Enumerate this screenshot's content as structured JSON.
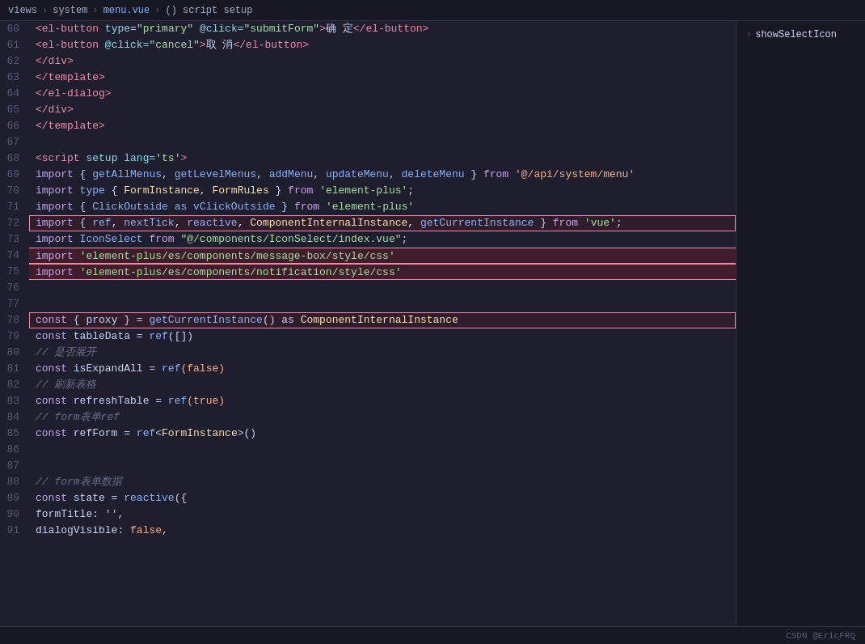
{
  "breadcrumb": {
    "parts": [
      "views",
      "system",
      "menu.vue",
      "() script setup"
    ]
  },
  "right_panel": {
    "item": "showSelectIcon",
    "arrow": "›"
  },
  "lines": [
    {
      "num": 60,
      "tokens": [
        {
          "t": "                    ",
          "c": ""
        },
        {
          "t": "<",
          "c": "tag"
        },
        {
          "t": "el-button",
          "c": "tag"
        },
        {
          "t": " ",
          "c": ""
        },
        {
          "t": "type",
          "c": "attr"
        },
        {
          "t": "=",
          "c": "punct"
        },
        {
          "t": "\"primary\"",
          "c": "str"
        },
        {
          "t": " @click=",
          "c": "attr"
        },
        {
          "t": "\"submitForm\"",
          "c": "str"
        },
        {
          "t": ">",
          "c": "tag"
        },
        {
          "t": "确 定",
          "c": "white"
        },
        {
          "t": "</",
          "c": "tag"
        },
        {
          "t": "el-button",
          "c": "tag"
        },
        {
          "t": ">",
          "c": "tag"
        }
      ]
    },
    {
      "num": 61,
      "tokens": [
        {
          "t": "                    ",
          "c": ""
        },
        {
          "t": "<",
          "c": "tag"
        },
        {
          "t": "el-button",
          "c": "tag"
        },
        {
          "t": " @click=",
          "c": "attr"
        },
        {
          "t": "\"cancel\"",
          "c": "str"
        },
        {
          "t": ">",
          "c": "tag"
        },
        {
          "t": "取 消",
          "c": "white"
        },
        {
          "t": "</",
          "c": "tag"
        },
        {
          "t": "el-button",
          "c": "tag"
        },
        {
          "t": ">",
          "c": "tag"
        }
      ]
    },
    {
      "num": 62,
      "tokens": [
        {
          "t": "                ",
          "c": ""
        },
        {
          "t": "</",
          "c": "tag"
        },
        {
          "t": "div",
          "c": "tag"
        },
        {
          "t": ">",
          "c": "tag"
        }
      ]
    },
    {
      "num": 63,
      "tokens": [
        {
          "t": "            ",
          "c": ""
        },
        {
          "t": "</",
          "c": "tag"
        },
        {
          "t": "template",
          "c": "tag"
        },
        {
          "t": ">",
          "c": "tag"
        }
      ]
    },
    {
      "num": 64,
      "tokens": [
        {
          "t": "        ",
          "c": ""
        },
        {
          "t": "</",
          "c": "tag"
        },
        {
          "t": "el-dialog",
          "c": "tag"
        },
        {
          "t": ">",
          "c": "tag"
        }
      ]
    },
    {
      "num": 65,
      "tokens": [
        {
          "t": "    ",
          "c": ""
        },
        {
          "t": "</",
          "c": "tag"
        },
        {
          "t": "div",
          "c": "tag"
        },
        {
          "t": ">",
          "c": "tag"
        }
      ]
    },
    {
      "num": 66,
      "tokens": [
        {
          "t": "</",
          "c": "tag"
        },
        {
          "t": "template",
          "c": "tag"
        },
        {
          "t": ">",
          "c": "tag"
        }
      ]
    },
    {
      "num": 67,
      "tokens": []
    },
    {
      "num": 68,
      "tokens": [
        {
          "t": "<",
          "c": "tag"
        },
        {
          "t": "script",
          "c": "tag"
        },
        {
          "t": " setup",
          "c": "attr"
        },
        {
          "t": " lang=",
          "c": "attr"
        },
        {
          "t": "'ts'",
          "c": "str"
        },
        {
          "t": ">",
          "c": "tag"
        }
      ]
    },
    {
      "num": 69,
      "tokens": [
        {
          "t": "import",
          "c": "kw"
        },
        {
          "t": " { ",
          "c": "white"
        },
        {
          "t": "getAllMenus",
          "c": "fn"
        },
        {
          "t": ", ",
          "c": "white"
        },
        {
          "t": "getLevelMenus",
          "c": "fn"
        },
        {
          "t": ", ",
          "c": "white"
        },
        {
          "t": "addMenu",
          "c": "fn"
        },
        {
          "t": ", ",
          "c": "white"
        },
        {
          "t": "updateMenu",
          "c": "fn"
        },
        {
          "t": ", ",
          "c": "white"
        },
        {
          "t": "deleteMenu",
          "c": "fn"
        },
        {
          "t": " } ",
          "c": "white"
        },
        {
          "t": "from",
          "c": "kw"
        },
        {
          "t": " ",
          "c": ""
        },
        {
          "t": "'@/api/system/menu'",
          "c": "str-orange"
        }
      ]
    },
    {
      "num": 70,
      "tokens": [
        {
          "t": "import",
          "c": "kw"
        },
        {
          "t": " type",
          "c": "kw2"
        },
        {
          "t": " { ",
          "c": "white"
        },
        {
          "t": "FormInstance",
          "c": "type"
        },
        {
          "t": ", ",
          "c": "white"
        },
        {
          "t": "FormRules",
          "c": "type"
        },
        {
          "t": " } ",
          "c": "white"
        },
        {
          "t": "from",
          "c": "kw"
        },
        {
          "t": " ",
          "c": ""
        },
        {
          "t": "'element-plus'",
          "c": "str"
        },
        {
          "t": ";",
          "c": "white"
        }
      ]
    },
    {
      "num": 71,
      "tokens": [
        {
          "t": "import",
          "c": "kw"
        },
        {
          "t": " { ",
          "c": "white"
        },
        {
          "t": "ClickOutside",
          "c": "fn"
        },
        {
          "t": " as ",
          "c": "kw2"
        },
        {
          "t": "vClickOutside",
          "c": "fn"
        },
        {
          "t": " } ",
          "c": "white"
        },
        {
          "t": "from",
          "c": "kw"
        },
        {
          "t": " ",
          "c": ""
        },
        {
          "t": "'element-plus'",
          "c": "str"
        }
      ]
    },
    {
      "num": 72,
      "tokens": [
        {
          "t": "import",
          "c": "kw"
        },
        {
          "t": " { ",
          "c": "white"
        },
        {
          "t": "ref",
          "c": "fn"
        },
        {
          "t": ", ",
          "c": "white"
        },
        {
          "t": "nextTick",
          "c": "fn"
        },
        {
          "t": ", ",
          "c": "white"
        },
        {
          "t": "reactive",
          "c": "fn"
        },
        {
          "t": ", ",
          "c": "white"
        },
        {
          "t": "ComponentInternalInstance",
          "c": "type"
        },
        {
          "t": ", ",
          "c": "white"
        },
        {
          "t": "getCurrentInstance",
          "c": "fn"
        },
        {
          "t": " } ",
          "c": "white"
        },
        {
          "t": "from",
          "c": "kw"
        },
        {
          "t": " ",
          "c": ""
        },
        {
          "t": "'vue'",
          "c": "str"
        },
        {
          "t": ";",
          "c": "white"
        }
      ],
      "box": true
    },
    {
      "num": 73,
      "tokens": [
        {
          "t": "import",
          "c": "kw"
        },
        {
          "t": " IconSelect ",
          "c": "fn"
        },
        {
          "t": "from",
          "c": "kw"
        },
        {
          "t": " ",
          "c": ""
        },
        {
          "t": "\"@/components/IconSelect/index.vue\"",
          "c": "str"
        },
        {
          "t": ";",
          "c": "white"
        }
      ]
    },
    {
      "num": 74,
      "tokens": [
        {
          "t": "import",
          "c": "kw"
        },
        {
          "t": " ",
          "c": ""
        },
        {
          "t": "'element-plus/es/components/message-box/style/css'",
          "c": "str"
        }
      ],
      "highlight": true
    },
    {
      "num": 75,
      "tokens": [
        {
          "t": "import",
          "c": "kw"
        },
        {
          "t": " ",
          "c": ""
        },
        {
          "t": "'element-plus/es/components/notification/style/css'",
          "c": "str"
        }
      ],
      "highlight": true
    },
    {
      "num": 76,
      "tokens": []
    },
    {
      "num": 77,
      "tokens": []
    },
    {
      "num": 78,
      "tokens": [
        {
          "t": "const",
          "c": "kw"
        },
        {
          "t": " { ",
          "c": "white"
        },
        {
          "t": "proxy",
          "c": "var"
        },
        {
          "t": " } = ",
          "c": "white"
        },
        {
          "t": "getCurrentInstance",
          "c": "fn"
        },
        {
          "t": "() as ",
          "c": "white"
        },
        {
          "t": "ComponentInternalInstance",
          "c": "type"
        }
      ],
      "box": true
    },
    {
      "num": 79,
      "tokens": [
        {
          "t": "const",
          "c": "kw"
        },
        {
          "t": " tableData = ",
          "c": "white"
        },
        {
          "t": "ref",
          "c": "fn"
        },
        {
          "t": "([])",
          "c": "white"
        }
      ]
    },
    {
      "num": 80,
      "tokens": [
        {
          "t": "// 是否展开",
          "c": "comment-cn"
        }
      ]
    },
    {
      "num": 81,
      "tokens": [
        {
          "t": "const",
          "c": "kw"
        },
        {
          "t": " isExpandAll = ",
          "c": "white"
        },
        {
          "t": "ref",
          "c": "fn"
        },
        {
          "t": "(false)",
          "c": "orange"
        }
      ]
    },
    {
      "num": 82,
      "tokens": [
        {
          "t": "// 刷新表格",
          "c": "comment-cn"
        }
      ]
    },
    {
      "num": 83,
      "tokens": [
        {
          "t": "const",
          "c": "kw"
        },
        {
          "t": " refreshTable = ",
          "c": "white"
        },
        {
          "t": "ref",
          "c": "fn"
        },
        {
          "t": "(true)",
          "c": "orange"
        }
      ]
    },
    {
      "num": 84,
      "tokens": [
        {
          "t": "// form表单ref",
          "c": "comment-cn"
        }
      ]
    },
    {
      "num": 85,
      "tokens": [
        {
          "t": "const",
          "c": "kw"
        },
        {
          "t": " refForm = ",
          "c": "white"
        },
        {
          "t": "ref",
          "c": "fn"
        },
        {
          "t": "<",
          "c": "white"
        },
        {
          "t": "FormInstance",
          "c": "type"
        },
        {
          "t": ">()",
          "c": "white"
        }
      ]
    },
    {
      "num": 86,
      "tokens": []
    },
    {
      "num": 87,
      "tokens": []
    },
    {
      "num": 88,
      "tokens": [
        {
          "t": "// form表单数据",
          "c": "comment-cn"
        }
      ]
    },
    {
      "num": 89,
      "tokens": [
        {
          "t": "const",
          "c": "kw"
        },
        {
          "t": " state = ",
          "c": "white"
        },
        {
          "t": "reactive",
          "c": "fn"
        },
        {
          "t": "({",
          "c": "white"
        }
      ]
    },
    {
      "num": 90,
      "tokens": [
        {
          "t": "    formTitle: ",
          "c": "white"
        },
        {
          "t": "''",
          "c": "str"
        },
        {
          "t": ",",
          "c": "white"
        }
      ]
    },
    {
      "num": 91,
      "tokens": [
        {
          "t": "    dialogVisible: ",
          "c": "white"
        },
        {
          "t": "false",
          "c": "orange"
        },
        {
          "t": ",",
          "c": "white"
        }
      ]
    }
  ],
  "status_bar": {
    "author": "CSDN @EricFRQ"
  }
}
